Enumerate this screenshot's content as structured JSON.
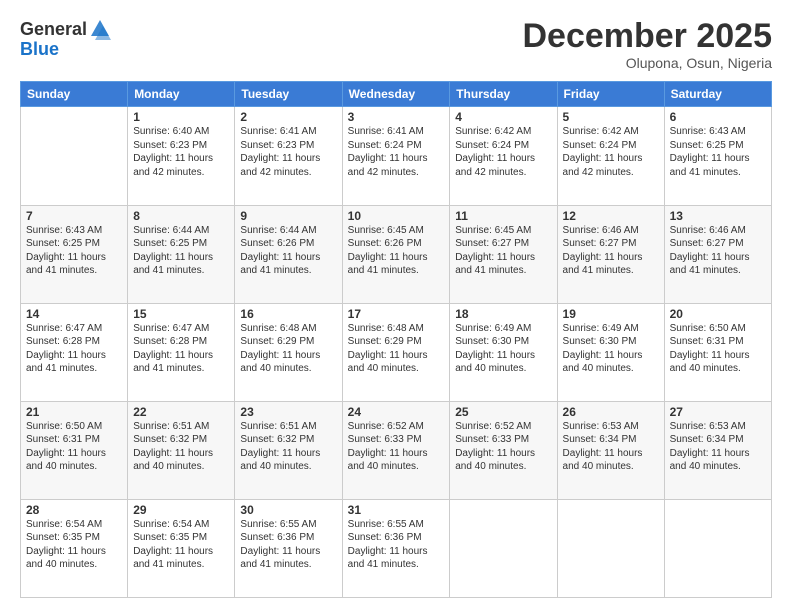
{
  "logo": {
    "general": "General",
    "blue": "Blue"
  },
  "header": {
    "month_year": "December 2025",
    "location": "Olupona, Osun, Nigeria"
  },
  "days_of_week": [
    "Sunday",
    "Monday",
    "Tuesday",
    "Wednesday",
    "Thursday",
    "Friday",
    "Saturday"
  ],
  "weeks": [
    [
      {
        "day": "",
        "info": ""
      },
      {
        "day": "1",
        "info": "Sunrise: 6:40 AM\nSunset: 6:23 PM\nDaylight: 11 hours\nand 42 minutes."
      },
      {
        "day": "2",
        "info": "Sunrise: 6:41 AM\nSunset: 6:23 PM\nDaylight: 11 hours\nand 42 minutes."
      },
      {
        "day": "3",
        "info": "Sunrise: 6:41 AM\nSunset: 6:24 PM\nDaylight: 11 hours\nand 42 minutes."
      },
      {
        "day": "4",
        "info": "Sunrise: 6:42 AM\nSunset: 6:24 PM\nDaylight: 11 hours\nand 42 minutes."
      },
      {
        "day": "5",
        "info": "Sunrise: 6:42 AM\nSunset: 6:24 PM\nDaylight: 11 hours\nand 42 minutes."
      },
      {
        "day": "6",
        "info": "Sunrise: 6:43 AM\nSunset: 6:25 PM\nDaylight: 11 hours\nand 41 minutes."
      }
    ],
    [
      {
        "day": "7",
        "info": "Sunrise: 6:43 AM\nSunset: 6:25 PM\nDaylight: 11 hours\nand 41 minutes."
      },
      {
        "day": "8",
        "info": "Sunrise: 6:44 AM\nSunset: 6:25 PM\nDaylight: 11 hours\nand 41 minutes."
      },
      {
        "day": "9",
        "info": "Sunrise: 6:44 AM\nSunset: 6:26 PM\nDaylight: 11 hours\nand 41 minutes."
      },
      {
        "day": "10",
        "info": "Sunrise: 6:45 AM\nSunset: 6:26 PM\nDaylight: 11 hours\nand 41 minutes."
      },
      {
        "day": "11",
        "info": "Sunrise: 6:45 AM\nSunset: 6:27 PM\nDaylight: 11 hours\nand 41 minutes."
      },
      {
        "day": "12",
        "info": "Sunrise: 6:46 AM\nSunset: 6:27 PM\nDaylight: 11 hours\nand 41 minutes."
      },
      {
        "day": "13",
        "info": "Sunrise: 6:46 AM\nSunset: 6:27 PM\nDaylight: 11 hours\nand 41 minutes."
      }
    ],
    [
      {
        "day": "14",
        "info": "Sunrise: 6:47 AM\nSunset: 6:28 PM\nDaylight: 11 hours\nand 41 minutes."
      },
      {
        "day": "15",
        "info": "Sunrise: 6:47 AM\nSunset: 6:28 PM\nDaylight: 11 hours\nand 41 minutes."
      },
      {
        "day": "16",
        "info": "Sunrise: 6:48 AM\nSunset: 6:29 PM\nDaylight: 11 hours\nand 40 minutes."
      },
      {
        "day": "17",
        "info": "Sunrise: 6:48 AM\nSunset: 6:29 PM\nDaylight: 11 hours\nand 40 minutes."
      },
      {
        "day": "18",
        "info": "Sunrise: 6:49 AM\nSunset: 6:30 PM\nDaylight: 11 hours\nand 40 minutes."
      },
      {
        "day": "19",
        "info": "Sunrise: 6:49 AM\nSunset: 6:30 PM\nDaylight: 11 hours\nand 40 minutes."
      },
      {
        "day": "20",
        "info": "Sunrise: 6:50 AM\nSunset: 6:31 PM\nDaylight: 11 hours\nand 40 minutes."
      }
    ],
    [
      {
        "day": "21",
        "info": "Sunrise: 6:50 AM\nSunset: 6:31 PM\nDaylight: 11 hours\nand 40 minutes."
      },
      {
        "day": "22",
        "info": "Sunrise: 6:51 AM\nSunset: 6:32 PM\nDaylight: 11 hours\nand 40 minutes."
      },
      {
        "day": "23",
        "info": "Sunrise: 6:51 AM\nSunset: 6:32 PM\nDaylight: 11 hours\nand 40 minutes."
      },
      {
        "day": "24",
        "info": "Sunrise: 6:52 AM\nSunset: 6:33 PM\nDaylight: 11 hours\nand 40 minutes."
      },
      {
        "day": "25",
        "info": "Sunrise: 6:52 AM\nSunset: 6:33 PM\nDaylight: 11 hours\nand 40 minutes."
      },
      {
        "day": "26",
        "info": "Sunrise: 6:53 AM\nSunset: 6:34 PM\nDaylight: 11 hours\nand 40 minutes."
      },
      {
        "day": "27",
        "info": "Sunrise: 6:53 AM\nSunset: 6:34 PM\nDaylight: 11 hours\nand 40 minutes."
      }
    ],
    [
      {
        "day": "28",
        "info": "Sunrise: 6:54 AM\nSunset: 6:35 PM\nDaylight: 11 hours\nand 40 minutes."
      },
      {
        "day": "29",
        "info": "Sunrise: 6:54 AM\nSunset: 6:35 PM\nDaylight: 11 hours\nand 41 minutes."
      },
      {
        "day": "30",
        "info": "Sunrise: 6:55 AM\nSunset: 6:36 PM\nDaylight: 11 hours\nand 41 minutes."
      },
      {
        "day": "31",
        "info": "Sunrise: 6:55 AM\nSunset: 6:36 PM\nDaylight: 11 hours\nand 41 minutes."
      },
      {
        "day": "",
        "info": ""
      },
      {
        "day": "",
        "info": ""
      },
      {
        "day": "",
        "info": ""
      }
    ]
  ]
}
